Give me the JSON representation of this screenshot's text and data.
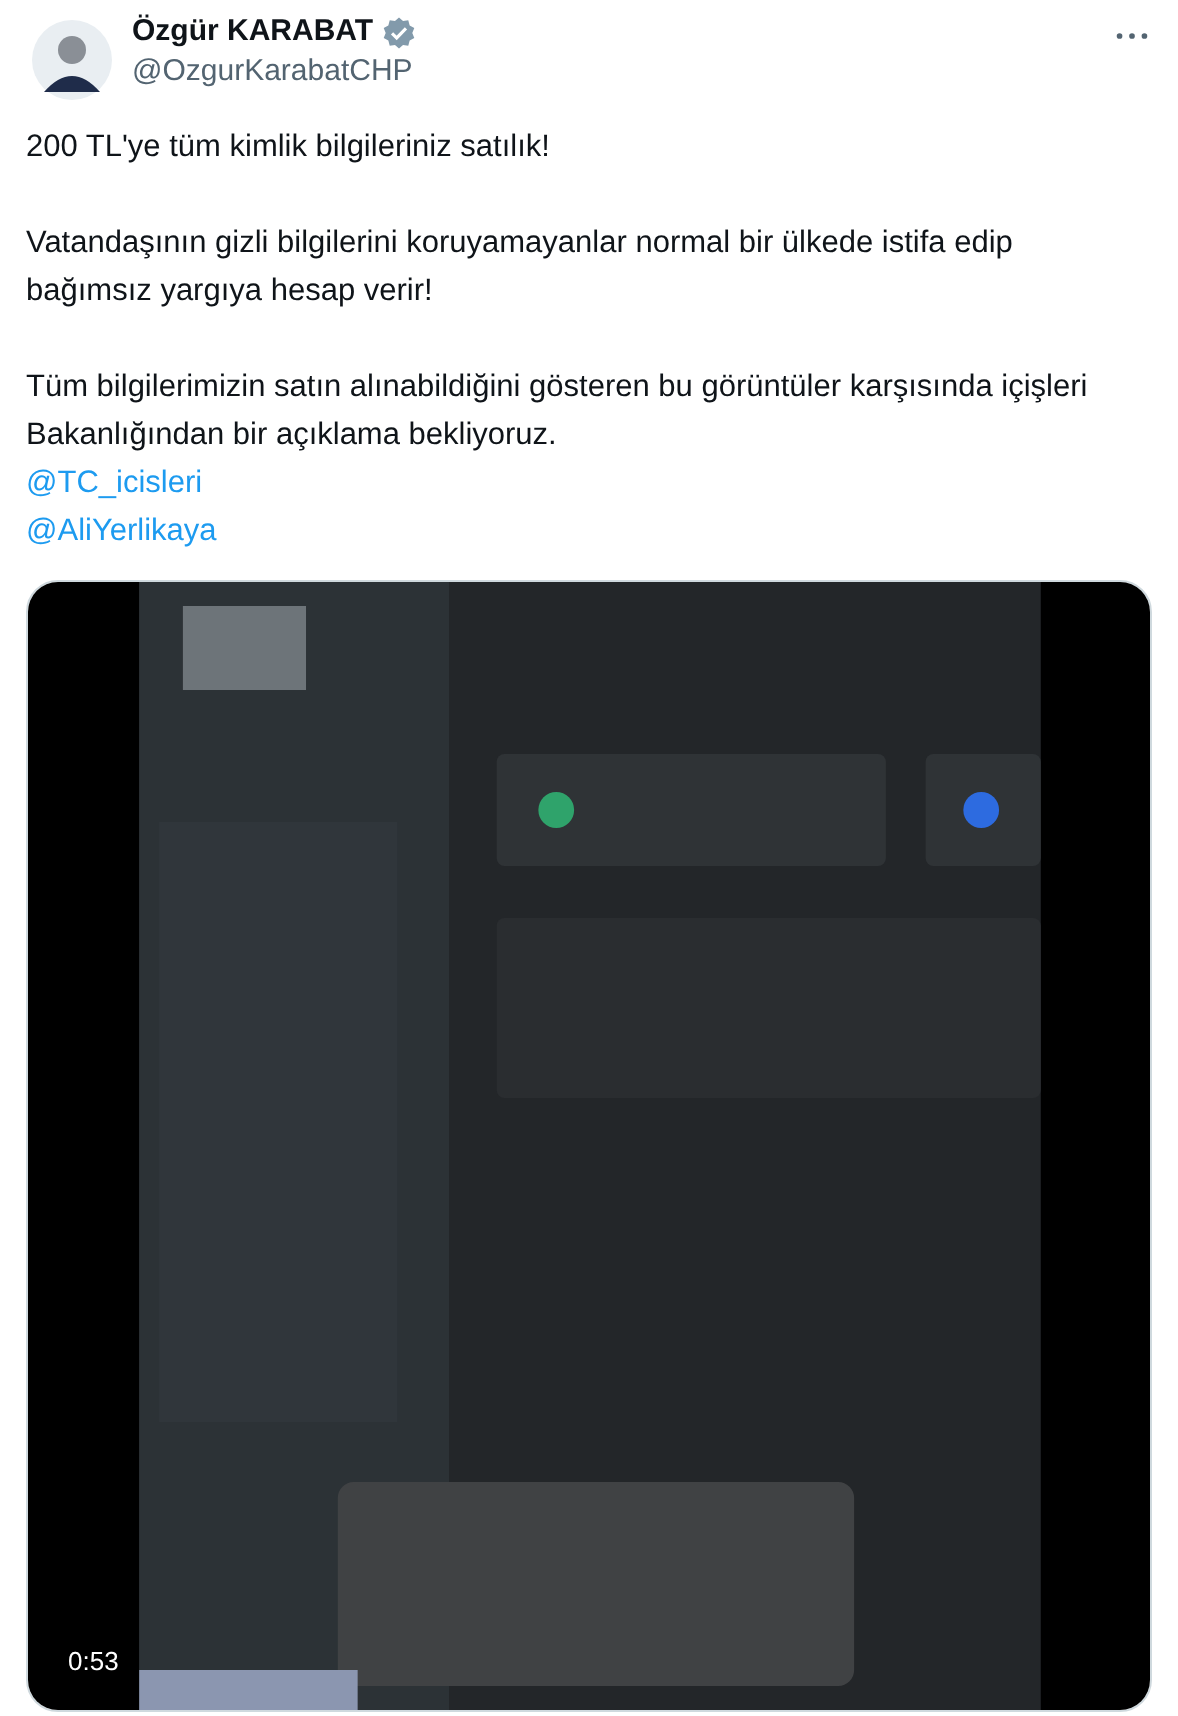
{
  "author": {
    "name": "Özgür KARABAT",
    "verified": true,
    "handle": "@OzgurKarabatCHP"
  },
  "paragraphs": [
    "200 TL'ye tüm kimlik bilgileriniz satılık!",
    "Vatandaşının gizli bilgilerini koruyamayanlar normal bir ülkede istifa edip bağımsız yargıya hesap verir!",
    "Tüm bilgilerimizin satın alınabildiğini gösteren bu görüntüler karşısında içişleri Bakanlığından bir açıklama bekliyoruz."
  ],
  "mentions": [
    "@TC_icisleri",
    "@AliYerlikaya"
  ],
  "video": {
    "duration": "0:53"
  }
}
